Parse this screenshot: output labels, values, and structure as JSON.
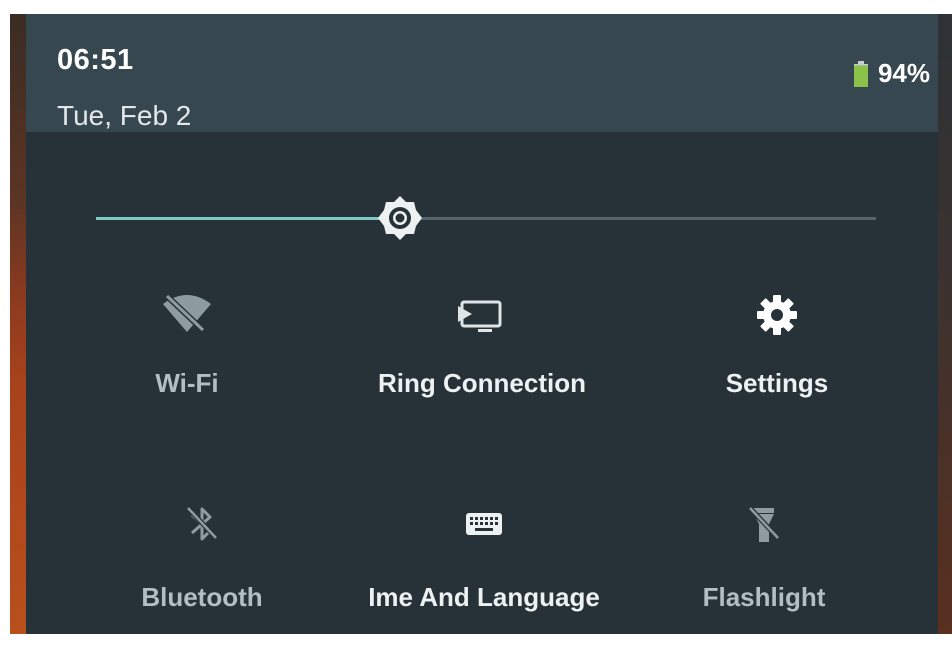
{
  "status_bar": {
    "time": "06:51",
    "date": "Tue, Feb 2",
    "battery_percent_text": "94%",
    "battery_level": 0.94
  },
  "brightness": {
    "level": 0.39,
    "icon": "brightness-icon"
  },
  "tiles": [
    {
      "label": "Wi-Fi",
      "icon": "wifi-off-icon",
      "state": "off"
    },
    {
      "label": "Ring Connection",
      "icon": "cast-icon",
      "state": "on"
    },
    {
      "label": "Settings",
      "icon": "gear-icon",
      "state": "on"
    },
    {
      "label": "Bluetooth",
      "icon": "bluetooth-off-icon",
      "state": "off"
    },
    {
      "label": "Ime And Language",
      "icon": "keyboard-icon",
      "state": "on"
    },
    {
      "label": "Flashlight",
      "icon": "flashlight-off-icon",
      "state": "off"
    }
  ],
  "colors": {
    "panel": "#263238",
    "header": "#37474f",
    "accent": "#7fcbc4",
    "battery": "#8bc34a"
  }
}
